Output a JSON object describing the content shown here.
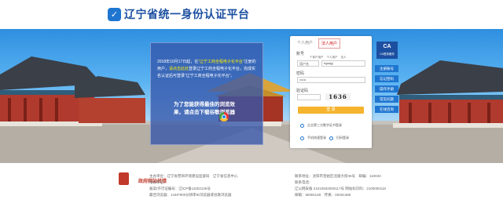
{
  "header": {
    "logo_icon": "shield-check-icon",
    "title": "辽宁省统一身份认证平台"
  },
  "notice": {
    "text_start": "2018年10月17日起，在",
    "text_hl": "“辽宁工商全程电子化平台”",
    "text_mid": "注册的用户，",
    "text_hl2": "请点击此处",
    "text_end": "登录辽宁工商全程电子化平台，完成实名认证后可登录“辽宁工商全程电子化平台”。",
    "tip": "为了您能获得最佳的浏览效果，请点击下载谷歌浏览器"
  },
  "login": {
    "tab_personal": "个人用户",
    "tab_legal": "法人用户",
    "account_label": "账号",
    "radios": [
      "个体户用户",
      "个人用户",
      "法人"
    ],
    "select_value": "用户名",
    "account_value": "hgszjg",
    "password_label": "密码",
    "password_value": "••••••",
    "captcha_label": "验证码",
    "captcha_value": "1636",
    "login_button": "登 录",
    "link_cert": "企业第三方数字证书登录",
    "link_phone": "手机快速登录",
    "link_qr": "扫码登录"
  },
  "ca": {
    "label": "CA",
    "sub": "CA登录服务"
  },
  "side_links": [
    "注册账号",
    "忘记密码",
    "操作手册",
    "常见问题",
    "在线咨询"
  ],
  "footer": {
    "col1": [
      "主办单位：辽宁省营商环境建设监督局　辽宁省信息中心",
      "承办单位：",
      "备案/许可证编号：辽ICP备11002126号",
      "最佳浏览器：1440*900分辨率IE浏览器或谷歌浏览器"
    ],
    "col2": [
      "联系地址：沈阳市皇姑区北陵大街45号　邮编：110033",
      "联系电话：",
      "辽公网安备 21010502000117号 网站标识码：2100000118",
      "邮箱：68381148　传真：00261386"
    ],
    "gov_link": "政府网站找错"
  }
}
